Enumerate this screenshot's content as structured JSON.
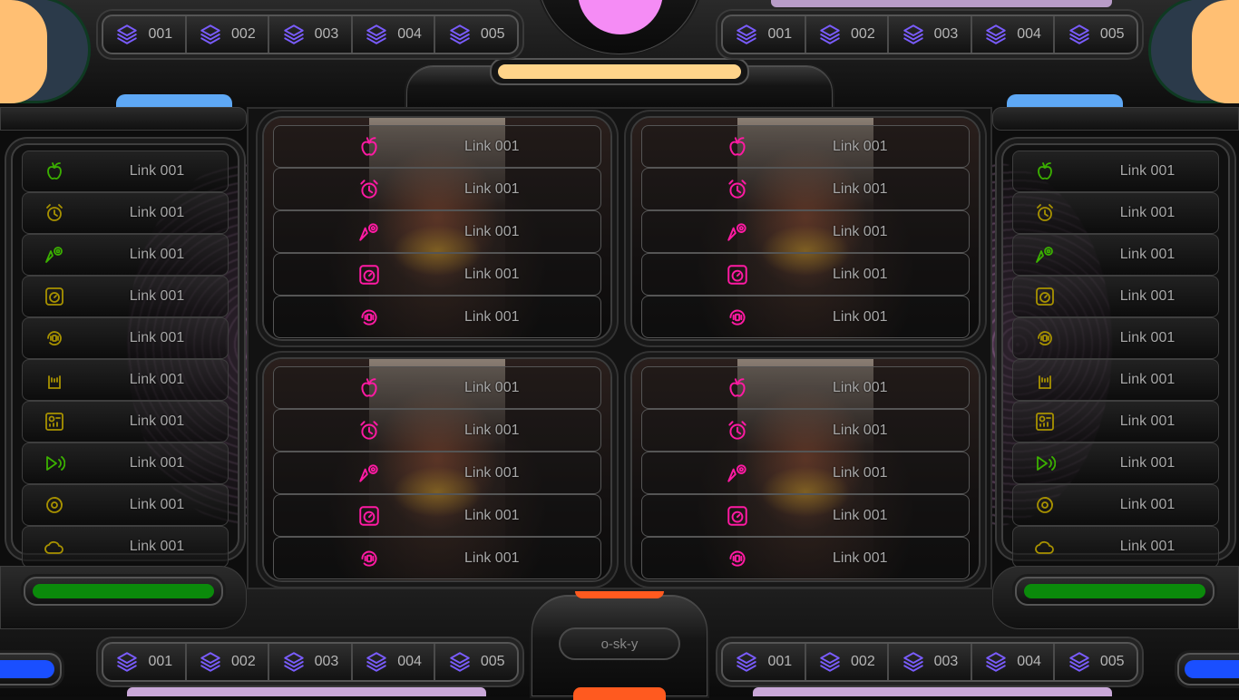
{
  "colors": {
    "peach": "#ffbf73",
    "pink_orb": "#f58cf5",
    "sky_blue": "#5ea8f5",
    "yellow_bar": "#ffd48a",
    "green_bar": "#0b8a0b",
    "orange": "#ff5a1f",
    "blue_bar": "#1a4fff",
    "lilac": "#c9a7d8",
    "icon_purple": "#7a5cff",
    "icon_magenta": "#ff1aa3",
    "icon_green": "#3bb000",
    "icon_olive": "#a89200"
  },
  "top_nav_left": {
    "icon": "layers-icon",
    "items": [
      {
        "label": "001"
      },
      {
        "label": "002"
      },
      {
        "label": "003"
      },
      {
        "label": "004"
      },
      {
        "label": "005"
      }
    ]
  },
  "top_nav_right": {
    "icon": "layers-icon",
    "items": [
      {
        "label": "001"
      },
      {
        "label": "002"
      },
      {
        "label": "003"
      },
      {
        "label": "004"
      },
      {
        "label": "005"
      }
    ]
  },
  "bottom_nav_left": {
    "icon": "layers-icon",
    "items": [
      {
        "label": "001"
      },
      {
        "label": "002"
      },
      {
        "label": "003"
      },
      {
        "label": "004"
      },
      {
        "label": "005"
      }
    ]
  },
  "bottom_nav_right": {
    "icon": "layers-icon",
    "items": [
      {
        "label": "001"
      },
      {
        "label": "002"
      },
      {
        "label": "003"
      },
      {
        "label": "004"
      },
      {
        "label": "005"
      }
    ]
  },
  "side_links": [
    {
      "label": "Link 001",
      "icon": "apple-icon"
    },
    {
      "label": "Link 001",
      "icon": "alarm-clock-icon"
    },
    {
      "label": "Link 001",
      "icon": "location-target-icon"
    },
    {
      "label": "Link 001",
      "icon": "timer-square-icon"
    },
    {
      "label": "Link 001",
      "icon": "vibrate-circle-icon"
    },
    {
      "label": "Link 001",
      "icon": "rock-hand-icon"
    },
    {
      "label": "Link 001",
      "icon": "dashboard-panel-icon"
    },
    {
      "label": "Link 001",
      "icon": "play-signal-icon"
    },
    {
      "label": "Link 001",
      "icon": "disc-icon"
    },
    {
      "label": "Link 001",
      "icon": "cloud-heart-icon"
    }
  ],
  "card_links": [
    {
      "label": "Link 001",
      "icon": "apple-icon"
    },
    {
      "label": "Link 001",
      "icon": "alarm-clock-icon"
    },
    {
      "label": "Link 001",
      "icon": "location-target-icon"
    },
    {
      "label": "Link 001",
      "icon": "timer-square-icon"
    },
    {
      "label": "Link 001",
      "icon": "vibrate-circle-icon"
    }
  ],
  "footer_badge": "o-sk-y"
}
